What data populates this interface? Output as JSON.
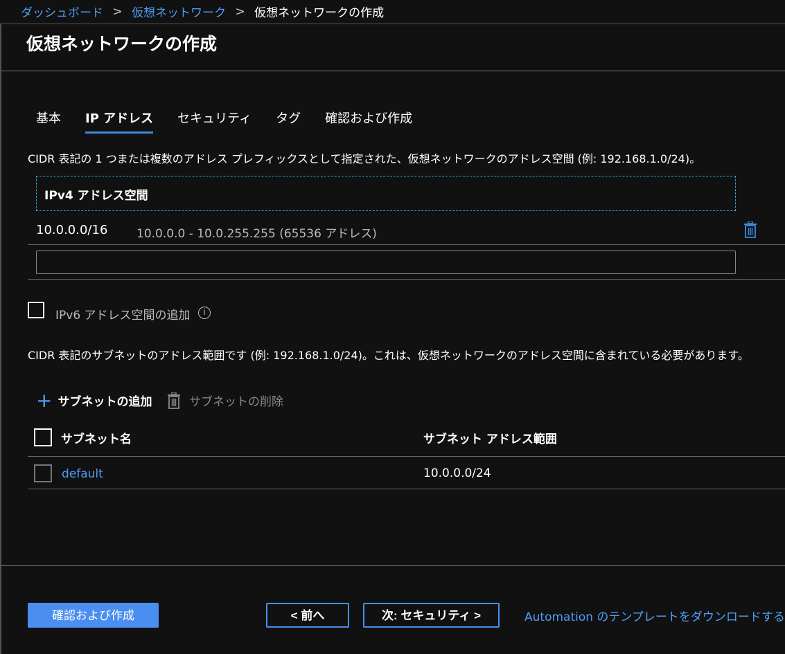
{
  "breadcrumb": {
    "items": [
      "ダッシュボード",
      "仮想ネットワーク"
    ],
    "current": "仮想ネットワークの作成",
    "separator": ">"
  },
  "page_title": "仮想ネットワークの作成",
  "tabs": [
    {
      "label": "基本",
      "active": false
    },
    {
      "label": "IP アドレス",
      "active": true
    },
    {
      "label": "セキュリティ",
      "active": false
    },
    {
      "label": "タグ",
      "active": false
    },
    {
      "label": "確認および作成",
      "active": false
    }
  ],
  "address_space": {
    "description": "CIDR 表記の 1 つまたは複数のアドレス プレフィックスとして指定された、仮想ネットワークのアドレス空間 (例: 192.168.1.0/24)。",
    "header": "IPv4 アドレス空間",
    "entries": [
      {
        "cidr": "10.0.0.0/16",
        "range": "10.0.0.0 - 10.0.255.255 (65536 アドレス)"
      }
    ],
    "new_entry_value": ""
  },
  "ipv6": {
    "label": "IPv6 アドレス空間の追加",
    "checked": false
  },
  "subnets": {
    "description": "CIDR 表記のサブネットのアドレス範囲です (例: 192.168.1.0/24)。これは、仮想ネットワークのアドレス空間に含まれている必要があります。",
    "add_label": "サブネットの追加",
    "delete_label": "サブネットの削除",
    "columns": [
      "サブネット名",
      "サブネット アドレス範囲"
    ],
    "rows": [
      {
        "name": "default",
        "range": "10.0.0.0/24"
      }
    ]
  },
  "footer": {
    "review_create": "確認および作成",
    "previous": "< 前へ",
    "next": "次: セキュリティ >",
    "download_link": "Automation のテンプレートをダウンロードする"
  },
  "colors": {
    "background": "#111111",
    "accent": "#4a8ef0",
    "link": "#4f9ef5",
    "dashed_border": "#3aa0d8"
  }
}
